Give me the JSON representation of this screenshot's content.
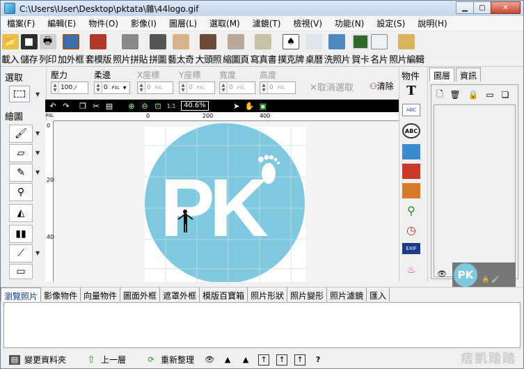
{
  "window": {
    "title": "C:\\Users\\User\\Desktop\\pktata\\雜\\44logo.gif"
  },
  "menu": [
    "檔案(F)",
    "編輯(E)",
    "物件(O)",
    "影像(I)",
    "圖層(L)",
    "選取(M)",
    "濾鏡(T)",
    "檢視(V)",
    "功能(N)",
    "設定(S)",
    "說明(H)"
  ],
  "toolbar": [
    {
      "label": "載入",
      "icon": "open-folder-icon"
    },
    {
      "label": "儲存",
      "icon": "save-icon"
    },
    {
      "label": "列印",
      "icon": "print-icon"
    },
    {
      "label": "加外框",
      "icon": "frame-icon"
    },
    {
      "label": "套模版",
      "icon": "template-icon"
    },
    {
      "label": "照片拼貼",
      "icon": "photo-collage-icon"
    },
    {
      "label": "拼圖",
      "icon": "puzzle-icon"
    },
    {
      "label": "藝太奇",
      "icon": "montage-icon"
    },
    {
      "label": "大頭照",
      "icon": "portrait-icon"
    },
    {
      "label": "縮圖頁",
      "icon": "thumbnail-page-icon"
    },
    {
      "label": "寫真書",
      "icon": "photobook-icon"
    },
    {
      "label": "撲克牌",
      "icon": "poker-icon"
    },
    {
      "label": "桌曆",
      "icon": "desk-calendar-icon"
    },
    {
      "label": "洗照片",
      "icon": "print-photo-icon"
    },
    {
      "label": "賀卡",
      "icon": "greeting-card-icon"
    },
    {
      "label": "名片",
      "icon": "business-card-icon"
    },
    {
      "label": "照片編輯",
      "icon": "photo-edit-icon"
    }
  ],
  "controls": {
    "pressure": {
      "label": "壓力",
      "value": "100"
    },
    "soft_edge": {
      "label": "柔邊",
      "value": "0",
      "unit": "PXL"
    },
    "x_coord": {
      "label": "X座標",
      "value": "0",
      "unit": "PXL"
    },
    "y_coord": {
      "label": "Y座標",
      "value": "0",
      "unit": "PXL"
    },
    "width": {
      "label": "寬度",
      "value": "0",
      "unit": "PXL"
    },
    "height": {
      "label": "高度",
      "value": "0",
      "unit": "PXL"
    },
    "cancel_selection": "取消選取",
    "clear": "清除"
  },
  "left_panel": {
    "select_title": "選取",
    "draw_title": "繪圖"
  },
  "canvas_bar": {
    "zoom": "40.6%",
    "fit_label": "1:1"
  },
  "ruler": {
    "unit": "PXL",
    "h_ticks": [
      "0",
      "200",
      "400"
    ],
    "v_ticks": [
      "0",
      "200",
      "400"
    ]
  },
  "logo": {
    "letters": "PK",
    "circle_color": "#7ec9df"
  },
  "object_panel": {
    "title": "物件",
    "items": [
      "T",
      "ABC",
      "ABC",
      "EXIF"
    ]
  },
  "right_panel": {
    "tabs": [
      "圖層",
      "資訊"
    ],
    "layer_thumb_text": "PK"
  },
  "bottom_tabs": [
    "瀏覽照片",
    "影像物件",
    "向量物件",
    "圖面外框",
    "遮罩外框",
    "模版百寶箱",
    "照片形狀",
    "照片變形",
    "照片濾鏡",
    "匯入"
  ],
  "status_bar": {
    "change_folder": "變更資料夾",
    "up_level": "上一層",
    "reorganize": "重新整理",
    "question": "?"
  },
  "watermark": "痞凱踏踏"
}
